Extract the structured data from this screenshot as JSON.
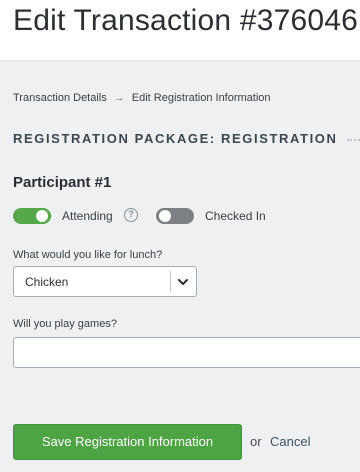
{
  "header": {
    "title": "Edit Transaction #376046"
  },
  "breadcrumb": {
    "items": [
      "Transaction Details",
      "Edit Registration Information"
    ],
    "separator": "→"
  },
  "section": {
    "heading": "REGISTRATION PACKAGE: REGISTRATION"
  },
  "participant": {
    "title": "Participant #1",
    "attending": {
      "label": "Attending",
      "on": true
    },
    "help_icon": "question-circle-icon",
    "checked_in": {
      "label": "Checked In",
      "on": false
    }
  },
  "lunch": {
    "label": "What would you like for lunch?",
    "selected": "Chicken",
    "icon": "chevron-down-icon"
  },
  "games": {
    "label": "Will you play games?",
    "value": "",
    "placeholder": ""
  },
  "actions": {
    "save_label": "Save Registration Information",
    "or_text": "or",
    "cancel_label": "Cancel"
  },
  "colors": {
    "accent_green": "#4ca443",
    "toggle_off": "#7e8184",
    "background": "#eef0f1"
  }
}
